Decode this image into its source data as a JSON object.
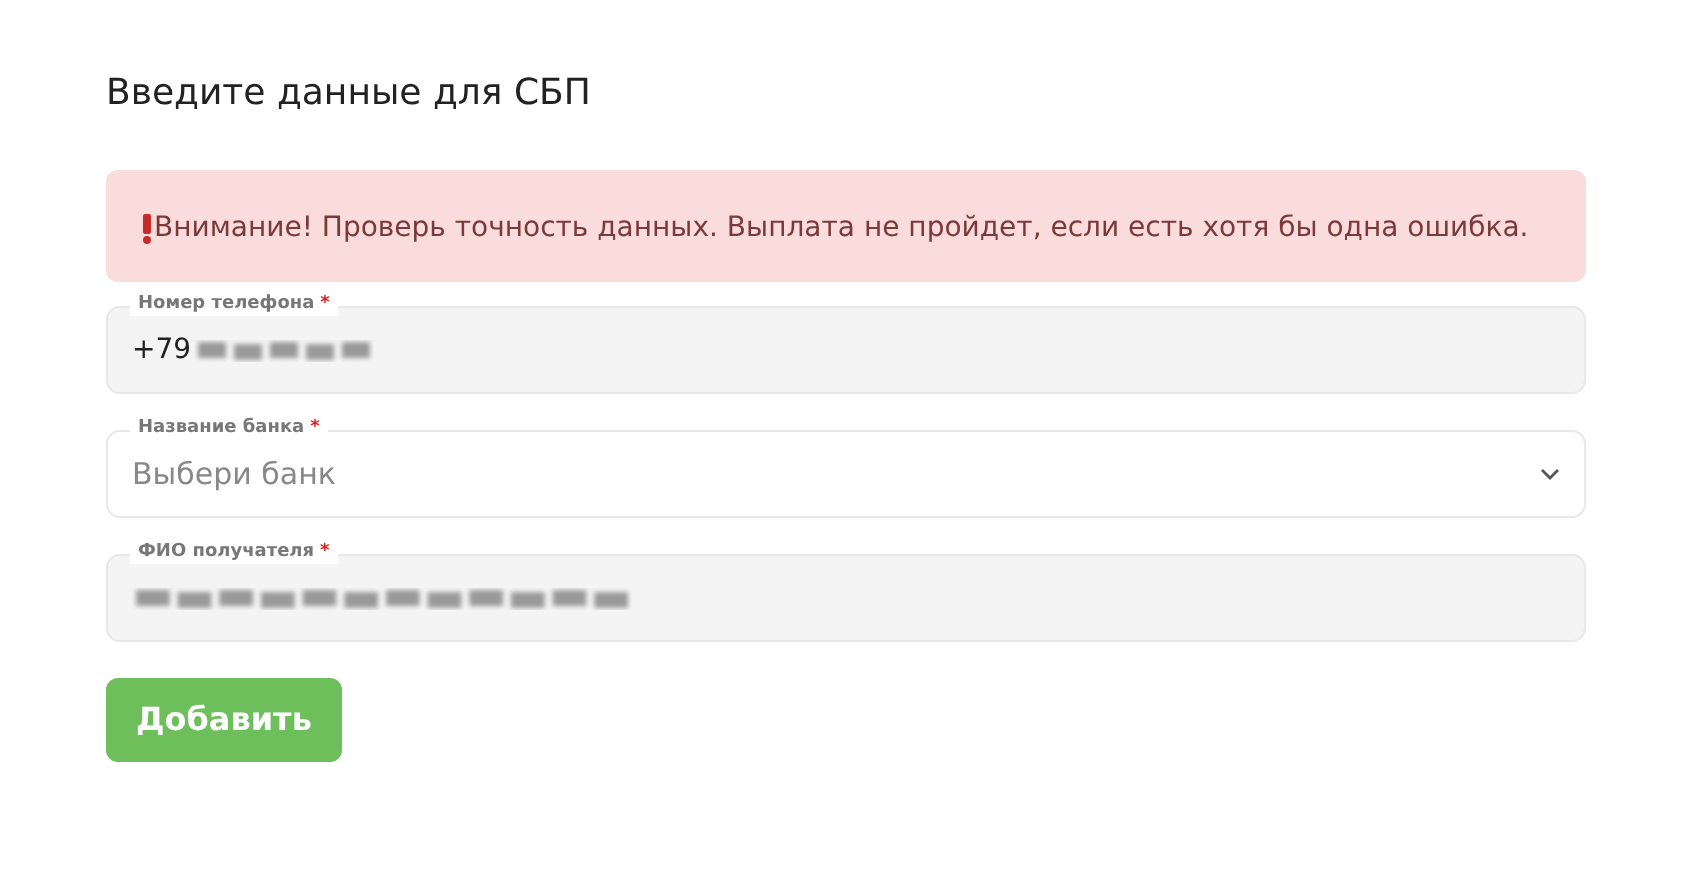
{
  "title": "Введите данные для СБП",
  "alert": {
    "text": "Внимание! Проверь точность данных. Выплата не пройдет, если есть хотя бы одна ошибка."
  },
  "fields": [
    {
      "kind": "input",
      "label": "Номер телефона",
      "required_mark": "*",
      "value": "+79",
      "blurred": true
    },
    {
      "kind": "select",
      "label": "Название банка",
      "required_mark": "*",
      "placeholder": "Выбери банк",
      "blurred": false
    },
    {
      "kind": "input",
      "label": "ФИО получателя",
      "required_mark": "*",
      "blurred": true
    }
  ],
  "submit": {
    "label": "Добавить"
  }
}
